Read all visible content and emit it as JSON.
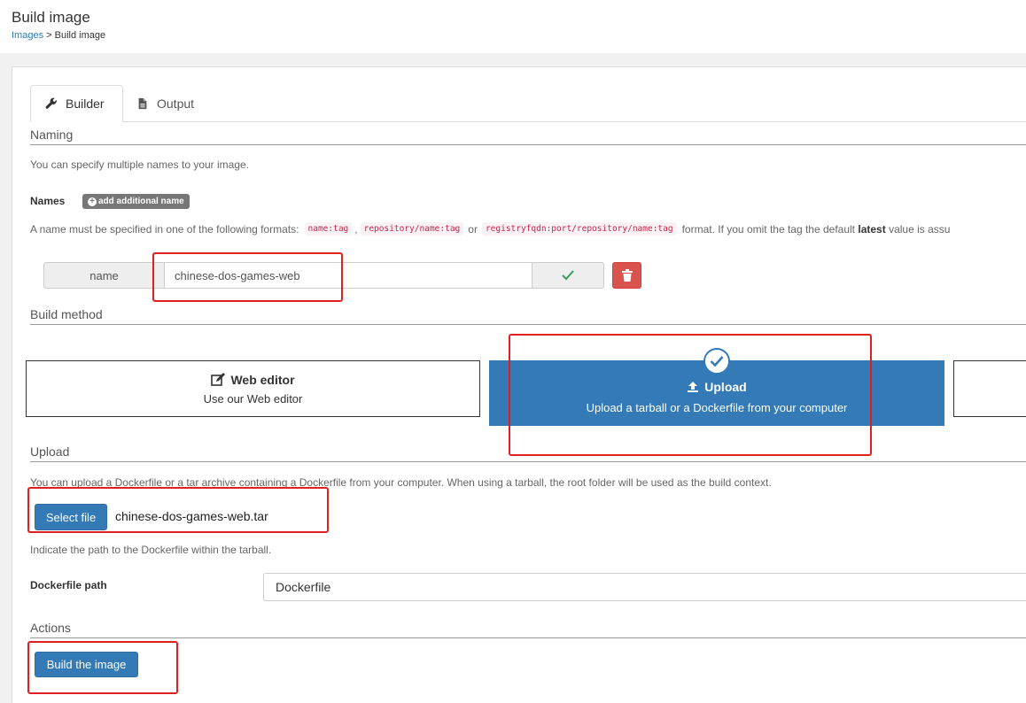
{
  "header": {
    "title": "Build image",
    "breadcrumb": {
      "link": "Images",
      "separator": " > ",
      "current": "Build image"
    }
  },
  "tabs": [
    {
      "label": "Builder",
      "icon": "wrench-icon",
      "active": true
    },
    {
      "label": "Output",
      "icon": "file-icon",
      "active": false
    }
  ],
  "naming": {
    "title": "Naming",
    "help": "You can specify multiple names to your image.",
    "names_label": "Names",
    "add_name_label": "add additional name",
    "format_intro": "A name must be specified in one of the following formats:",
    "formats": [
      "name:tag",
      "repository/name:tag",
      "registryfqdn:port/repository/name:tag"
    ],
    "format_sep1": ",",
    "format_sep2": "or",
    "format_outro1": "format. If you omit the tag the default",
    "format_bold": "latest",
    "format_outro2": "value is assu",
    "name_addon": "name",
    "name_value": "chinese-dos-games-web"
  },
  "build_method": {
    "title": "Build method",
    "web_editor": {
      "title": "Web editor",
      "subtitle": "Use our Web editor"
    },
    "upload": {
      "title": "Upload",
      "subtitle": "Upload a tarball or a Dockerfile from your computer"
    }
  },
  "upload": {
    "title": "Upload",
    "help": "You can upload a Dockerfile or a tar archive containing a Dockerfile from your computer. When using a tarball, the root folder will be used as the build context.",
    "select_file_label": "Select file",
    "file_name": "chinese-dos-games-web.tar",
    "path_help": "Indicate the path to the Dockerfile within the tarball.",
    "dockerfile_path_label": "Dockerfile path",
    "dockerfile_path_value": "Dockerfile"
  },
  "actions": {
    "title": "Actions",
    "build_label": "Build the image"
  },
  "colors": {
    "primary": "#337ab7",
    "danger": "#d9534f",
    "success": "#3c9a5f",
    "highlight": "#e02020"
  }
}
